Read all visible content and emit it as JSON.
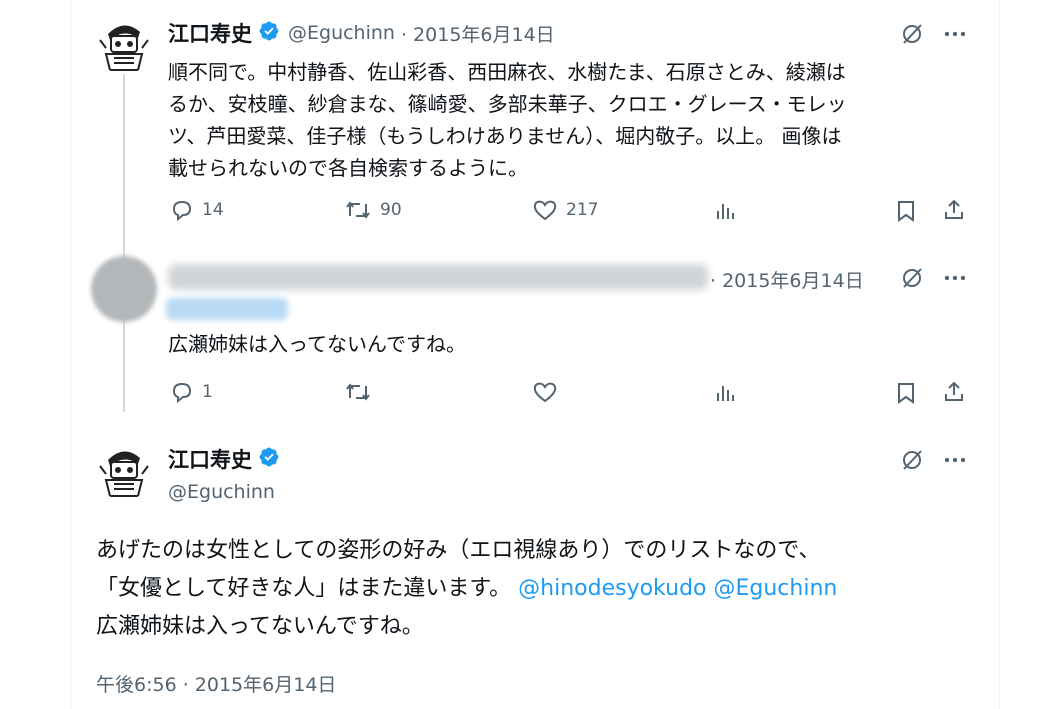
{
  "tweet1": {
    "name": "江口寿史",
    "handle": "@Eguchinn",
    "date": "· 2015年6月14日",
    "text_lines": [
      "順不同で。中村静香、佐山彩香、西田麻衣、水樹たま、石原さとみ、綾瀬は",
      "るか、安枝瞳、紗倉まな、篠崎愛、多部未華子、クロエ・グレース・モレッ",
      "ツ、芦田愛菜、佳子様（もうしわけありません）、堀内敬子。以上。 画像は",
      "載せられないので各自検索するように。"
    ],
    "replies": "14",
    "reposts": "90",
    "likes": "217"
  },
  "tweet2": {
    "date": "· 2015年6月14日",
    "text": "広瀬姉妹は入ってないんですね。",
    "replies": "1"
  },
  "tweet3": {
    "name": "江口寿史",
    "handle": "@Eguchinn",
    "text_line1": "あげたのは女性としての姿形の好み（エロ視線あり）でのリストなので、",
    "text_line2_prefix": "「女優として好きな人」はまた違います。",
    "mention1": "@hinodesyokudo",
    "mention2": "@Eguchinn",
    "text_line3": "広瀬姉妹は入ってないんですね。",
    "timestamp": "午後6:56 · 2015年6月14日"
  },
  "icons": [
    "grok-icon",
    "more-icon",
    "reply-icon",
    "repost-icon",
    "like-icon",
    "views-icon",
    "bookmark-icon",
    "share-icon",
    "verified-badge"
  ],
  "colors": {
    "accent": "#1d9bf0",
    "muted": "#536471",
    "line": "#cfd9de"
  }
}
